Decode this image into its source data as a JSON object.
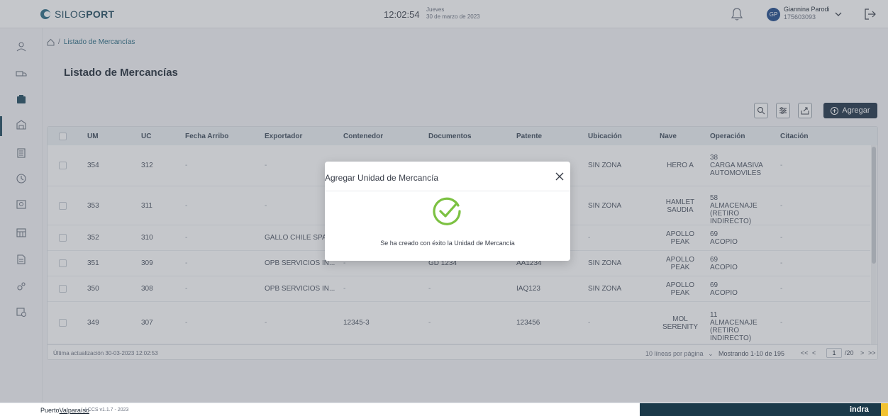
{
  "header": {
    "brand_a": "SILOG",
    "brand_b": "PORT",
    "time": "12:02:54",
    "day": "Jueves",
    "date": "30 de marzo de 2023",
    "user_initials": "GP",
    "user_name": "Giannina Parodi",
    "user_id": "175603093"
  },
  "breadcrumb": {
    "current": "Listado de Mercancías",
    "separator": "/"
  },
  "page": {
    "title": "Listado de Mercancías"
  },
  "toolbar": {
    "add_label": "Agregar"
  },
  "table": {
    "columns": [
      "UM",
      "UC",
      "Fecha Arribo",
      "Exportador",
      "Contenedor",
      "Documentos",
      "Patente",
      "Ubicación",
      "Nave",
      "Operación",
      "Citación"
    ],
    "rows": [
      {
        "um": "354",
        "uc": "312",
        "fecha": "-",
        "exportador": "-",
        "contenedor": "",
        "documentos": "",
        "patente": "",
        "ubicacion": "SIN ZONA",
        "nave": "HERO A",
        "op_num": "38",
        "op_desc": "CARGA MASIVA AUTOMOVILES",
        "citacion": "-"
      },
      {
        "um": "353",
        "uc": "311",
        "fecha": "-",
        "exportador": "-",
        "contenedor": "",
        "documentos": "",
        "patente": "",
        "ubicacion": "SIN ZONA",
        "nave": "HAMLET SAUDIA",
        "op_num": "58",
        "op_desc": "ALMACENAJE (RETIRO INDIRECTO)",
        "citacion": "-"
      },
      {
        "um": "352",
        "uc": "310",
        "fecha": "-",
        "exportador": "GALLO CHILE SPA",
        "contenedor": "",
        "documentos": "",
        "patente": "",
        "ubicacion": "-",
        "nave": "APOLLO PEAK",
        "op_num": "69",
        "op_desc": "ACOPIO",
        "citacion": "-"
      },
      {
        "um": "351",
        "uc": "309",
        "fecha": "-",
        "exportador": "OPB SERVICIOS IN...",
        "contenedor": "-",
        "documentos": "GD 1234",
        "patente": "AA1234",
        "ubicacion": "SIN ZONA",
        "nave": "APOLLO PEAK",
        "op_num": "69",
        "op_desc": "ACOPIO",
        "citacion": "-"
      },
      {
        "um": "350",
        "uc": "308",
        "fecha": "-",
        "exportador": "OPB SERVICIOS IN...",
        "contenedor": "-",
        "documentos": "-",
        "patente": "IAQ123",
        "ubicacion": "SIN ZONA",
        "nave": "APOLLO PEAK",
        "op_num": "69",
        "op_desc": "ACOPIO",
        "citacion": "-"
      },
      {
        "um": "349",
        "uc": "307",
        "fecha": "-",
        "exportador": "-",
        "contenedor": "12345-3",
        "documentos": "-",
        "patente": "123456",
        "ubicacion": "-",
        "nave": "MOL SERENITY",
        "op_num": "11",
        "op_desc": "ALMACENAJE (RETIRO INDIRECTO)",
        "citacion": "-"
      }
    ]
  },
  "table_footer": {
    "updated": "Última actualización 30-03-2023 12:02:53",
    "per_page": "10 líneas por página",
    "showing": "Mostrando 1-10 de 195",
    "first": "<<",
    "prev": "<",
    "page": "1",
    "total_pages": "/20",
    "next": ">",
    "last": ">>"
  },
  "modal": {
    "title": "Agregar Unidad de Mercancía",
    "message": "Se ha creado con éxito la Unidad de Mercancía"
  },
  "footer": {
    "brand_a": "Puerto",
    "brand_b": "Valparaíso",
    "version": "| CCS v1.1.7 - 2023",
    "partner": "indra"
  },
  "colors": {
    "primary": "#1f3347",
    "accent": "#2b6b83",
    "success": "#7cc142",
    "partner_bar": "#1b3a4a",
    "partner_accent": "#f2c230"
  }
}
